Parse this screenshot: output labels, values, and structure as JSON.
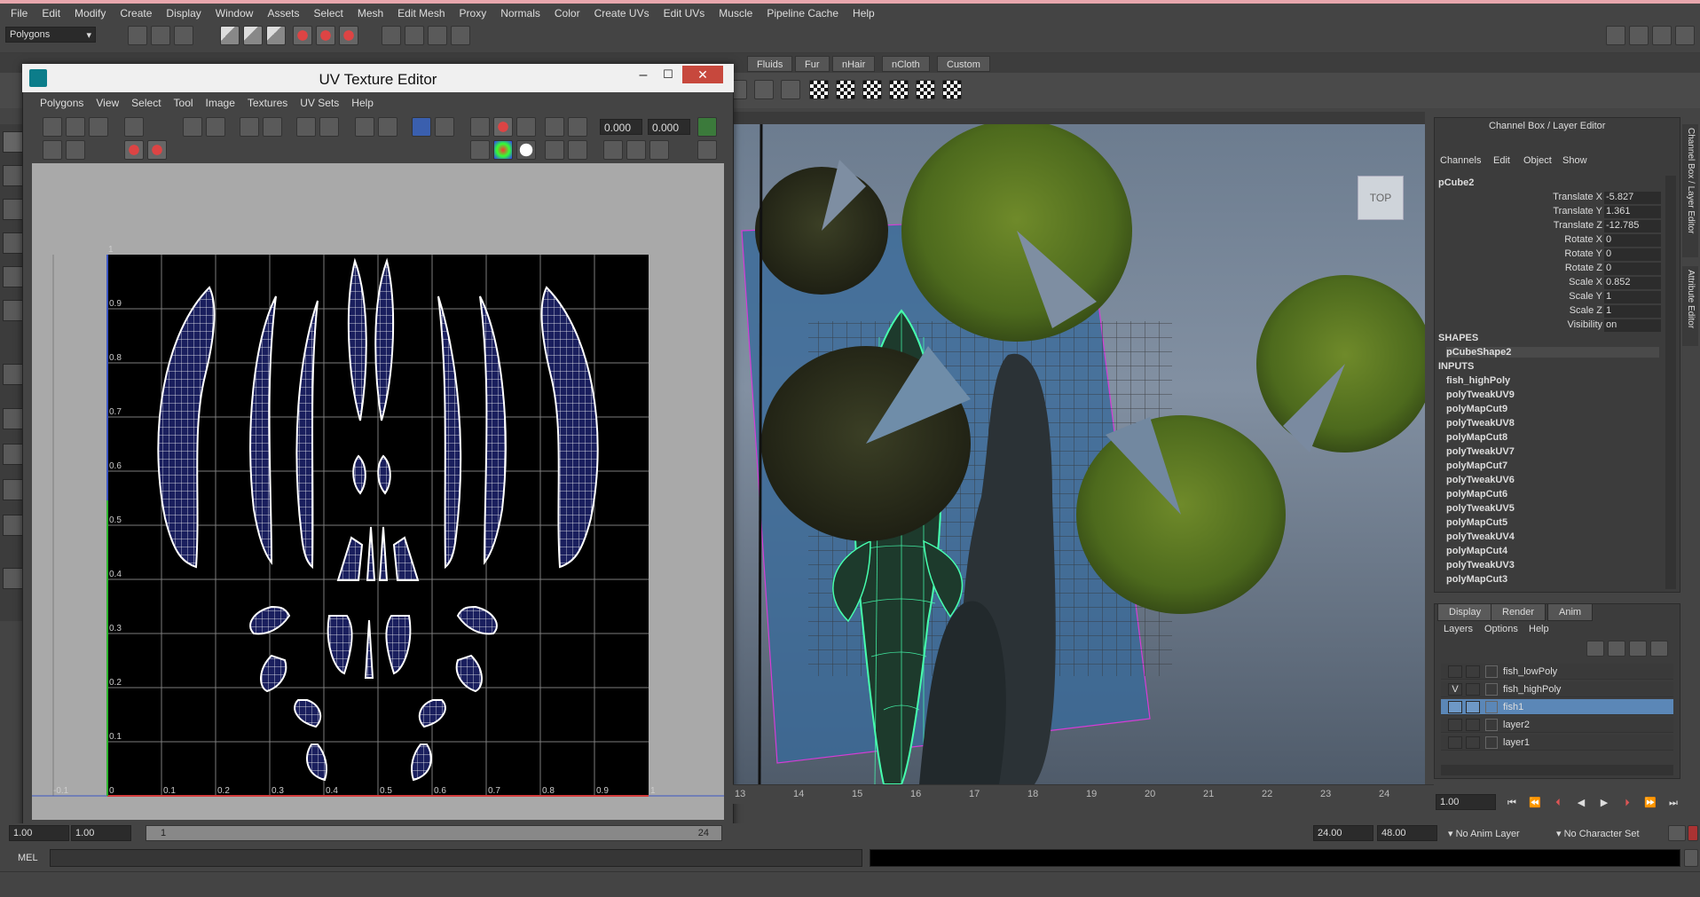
{
  "menubar": [
    "File",
    "Edit",
    "Modify",
    "Create",
    "Display",
    "Window",
    "Assets",
    "Select",
    "Mesh",
    "Edit Mesh",
    "Proxy",
    "Normals",
    "Color",
    "Create UVs",
    "Edit UVs",
    "Muscle",
    "Pipeline Cache",
    "Help"
  ],
  "mode_selector": "Polygons",
  "shelf_tabs": [
    "Fluids",
    "Fur",
    "nHair",
    "nCloth",
    "Custom"
  ],
  "uv_editor": {
    "title": "UV Texture Editor",
    "menu": [
      "Polygons",
      "View",
      "Select",
      "Tool",
      "Image",
      "Textures",
      "UV Sets",
      "Help"
    ],
    "u_field": "0.000",
    "v_field": "0.000",
    "grid_v_labels": [
      "1",
      "0.9",
      "0.8",
      "0.7",
      "0.6",
      "0.5",
      "0.4",
      "0.3",
      "0.2",
      "0.1"
    ],
    "grid_u_labels": [
      "-0.1",
      "0",
      "0.1",
      "0.2",
      "0.3",
      "0.4",
      "0.5",
      "0.6",
      "0.7",
      "0.8",
      "0.9",
      "1"
    ]
  },
  "viewport": {
    "view_cube_label": "TOP"
  },
  "channel_box": {
    "title": "Channel Box / Layer Editor",
    "menu": [
      "Channels",
      "Edit",
      "Object",
      "Show"
    ],
    "object": "pCube2",
    "attributes": [
      {
        "label": "Translate X",
        "value": "-5.827"
      },
      {
        "label": "Translate Y",
        "value": "1.361"
      },
      {
        "label": "Translate Z",
        "value": "-12.785"
      },
      {
        "label": "Rotate X",
        "value": "0"
      },
      {
        "label": "Rotate Y",
        "value": "0"
      },
      {
        "label": "Rotate Z",
        "value": "0"
      },
      {
        "label": "Scale X",
        "value": "0.852"
      },
      {
        "label": "Scale Y",
        "value": "1"
      },
      {
        "label": "Scale Z",
        "value": "1"
      },
      {
        "label": "Visibility",
        "value": "on"
      }
    ],
    "shapes_header": "SHAPES",
    "shapes": [
      "pCubeShape2"
    ],
    "inputs_header": "INPUTS",
    "inputs": [
      "fish_highPoly",
      "polyTweakUV9",
      "polyMapCut9",
      "polyTweakUV8",
      "polyMapCut8",
      "polyTweakUV7",
      "polyMapCut7",
      "polyTweakUV6",
      "polyMapCut6",
      "polyTweakUV5",
      "polyMapCut5",
      "polyTweakUV4",
      "polyMapCut4",
      "polyTweakUV3",
      "polyMapCut3"
    ],
    "side_tabs": [
      "Channel Box / Layer Editor",
      "Attribute Editor"
    ]
  },
  "layer_editor": {
    "tabs": [
      "Display",
      "Render",
      "Anim"
    ],
    "menu": [
      "Layers",
      "Options",
      "Help"
    ],
    "layers": [
      {
        "name": "fish_lowPoly",
        "visible": "",
        "selected": false
      },
      {
        "name": "fish_highPoly",
        "visible": "V",
        "selected": false
      },
      {
        "name": "fish1",
        "visible": "",
        "selected": true
      },
      {
        "name": "layer2",
        "visible": "",
        "selected": false
      },
      {
        "name": "layer1",
        "visible": "",
        "selected": false
      }
    ]
  },
  "timeline": {
    "ticks": [
      "13",
      "14",
      "15",
      "16",
      "17",
      "18",
      "19",
      "20",
      "21",
      "22",
      "23",
      "24"
    ],
    "current_frame": "1.00",
    "range_start": "1.00",
    "range_start2": "1.00",
    "range_marker": "1",
    "range_marker_end": "24",
    "range_end": "24.00",
    "range_end2": "48.00",
    "anim_layer": "No Anim Layer",
    "character_set": "No Character Set"
  },
  "command_line": {
    "label": "MEL"
  },
  "colors": {
    "uv_wire": "#ffffff",
    "uv_face": "#1a1f5e",
    "selection": "#5b87b7",
    "wire_green": "#44ffaa"
  }
}
